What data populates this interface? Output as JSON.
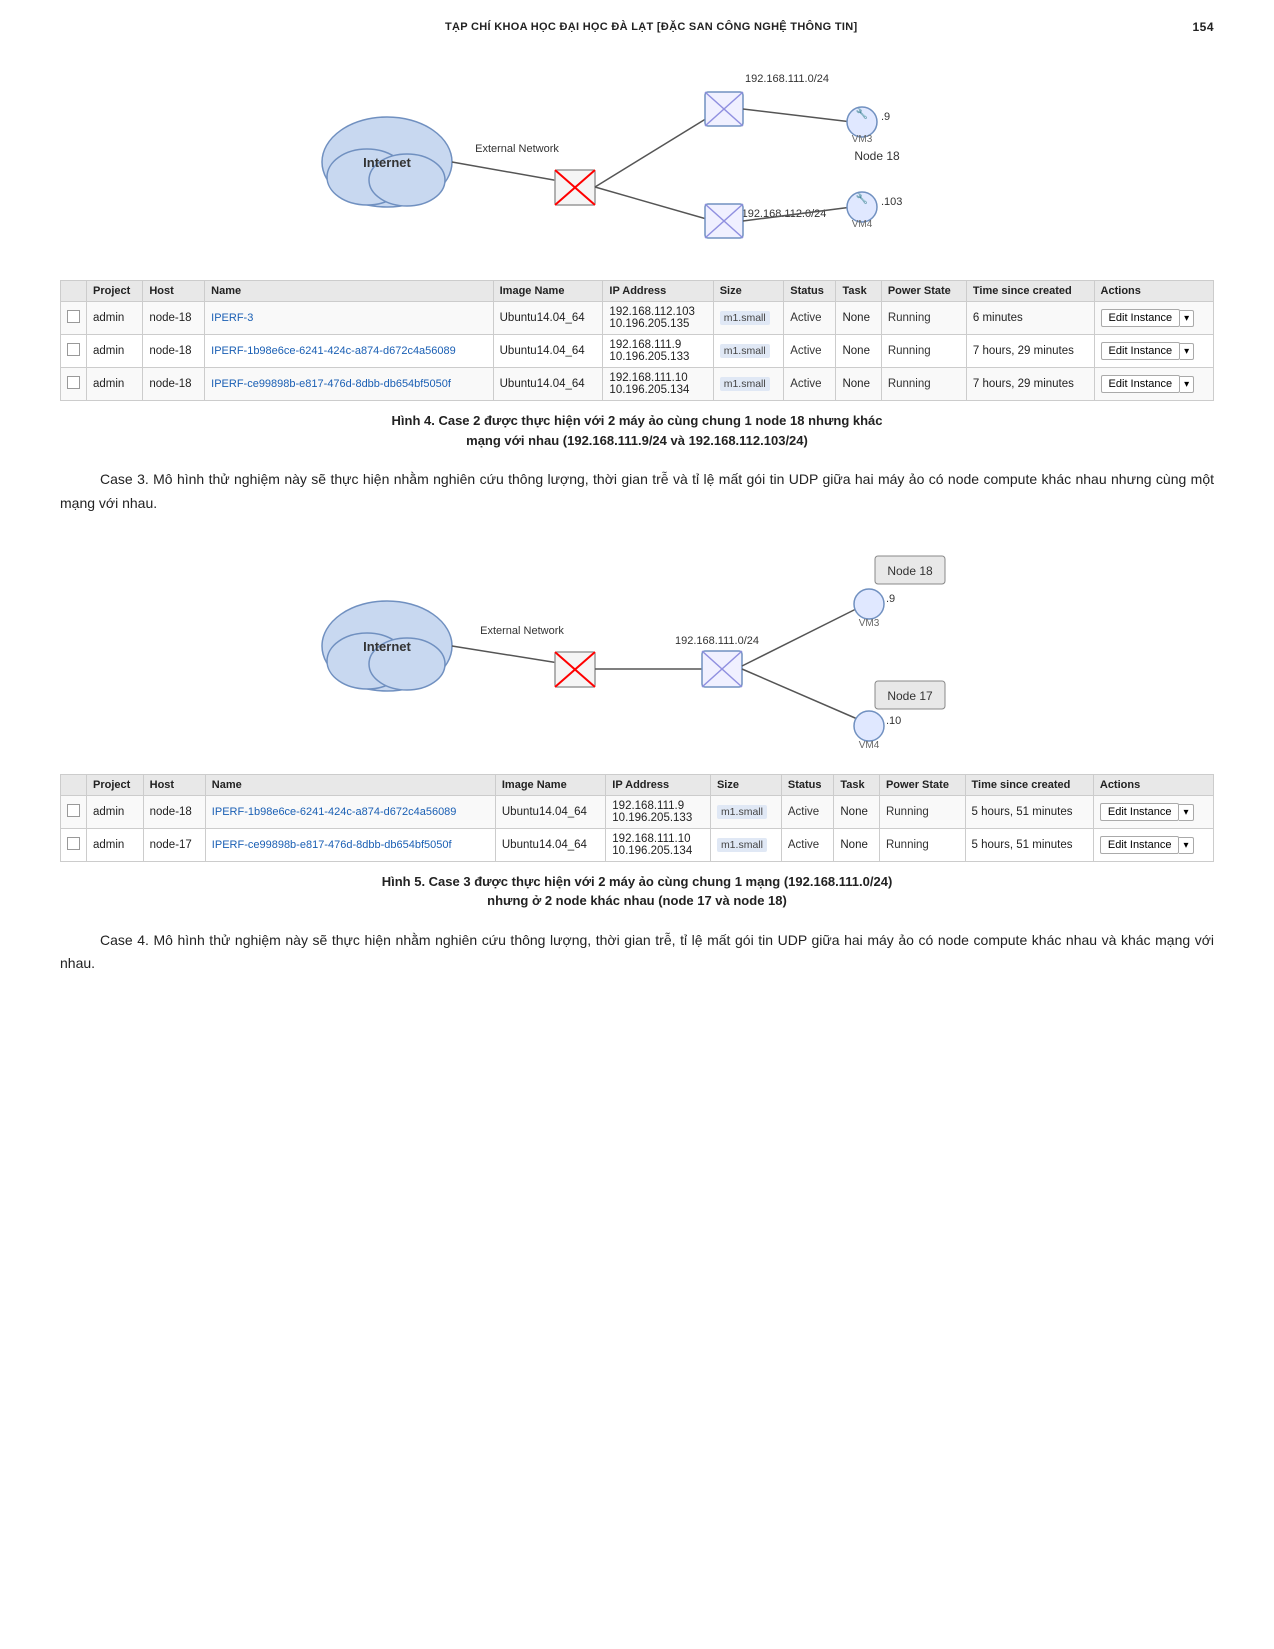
{
  "header": {
    "title": "TẠP CHÍ KHOA HỌC ĐẠI HỌC ĐÀ LẠT [ĐẶC SAN CÔNG NGHỆ THÔNG TIN]",
    "page_number": "154"
  },
  "figure4": {
    "caption_line1": "Hình 4. Case 2 được thực hiện với 2 máy ảo cùng chung 1 node 18 nhưng khác",
    "caption_line2": "mạng với nhau (192.168.111.9/24 và 192.168.112.103/24)"
  },
  "figure5": {
    "caption_line1": "Hình 5. Case 3 được thực hiện với 2 máy ảo cùng chung 1 mạng (192.168.111.0/24)",
    "caption_line2": "nhưng ở 2 node khác nhau (node 17 và node 18)"
  },
  "table4": {
    "rows": [
      {
        "project": "admin",
        "host": "node-18",
        "name": "IPERF-3",
        "image": "Ubuntu14.04_64",
        "ip1": "192.168.112.103",
        "ip2": "10.196.205.135",
        "size": "m1.small",
        "status": "Active",
        "task": "None",
        "power": "Running",
        "time": "6 minutes",
        "action1": "Edit Instance",
        "action2": "▾"
      },
      {
        "project": "admin",
        "host": "node-18",
        "name": "IPERF-1b98e6ce-6241-424c-a874-d672c4a56089",
        "image": "Ubuntu14.04_64",
        "ip1": "192.168.111.9",
        "ip2": "10.196.205.133",
        "size": "m1.small",
        "status": "Active",
        "task": "None",
        "power": "Running",
        "time": "7 hours, 29 minutes",
        "action1": "Edit Instance",
        "action2": "▾"
      },
      {
        "project": "admin",
        "host": "node-18",
        "name": "IPERF-ce99898b-e817-476d-8dbb-db654bf5050f",
        "image": "Ubuntu14.04_64",
        "ip1": "192.168.111.10",
        "ip2": "10.196.205.134",
        "size": "m1.small",
        "status": "Active",
        "task": "None",
        "power": "Running",
        "time": "7 hours, 29 minutes",
        "action1": "Edit Instance",
        "action2": "▾"
      }
    ]
  },
  "table5": {
    "columns": [
      "",
      "Project",
      "Host",
      "Name",
      "Image Name",
      "IP Address",
      "Size",
      "Status",
      "Task",
      "Power State",
      "Time since created",
      "Actions"
    ],
    "rows": [
      {
        "project": "admin",
        "host": "node-18",
        "name": "IPERF-1b98e6ce-6241-424c-a874-d672c4a56089",
        "image": "Ubuntu14.04_64",
        "ip1": "192.168.111.9",
        "ip2": "10.196.205.133",
        "size": "m1.small",
        "status": "Active",
        "task": "None",
        "power": "Running",
        "time": "5 hours, 51 minutes",
        "action1": "Edit Instance",
        "action2": "▾"
      },
      {
        "project": "admin",
        "host": "node-17",
        "name": "IPERF-ce99898b-e817-476d-8dbb-db654bf5050f",
        "image": "Ubuntu14.04_64",
        "ip1": "192.168.111.10",
        "ip2": "10.196.205.134",
        "size": "m1.small",
        "status": "Active",
        "task": "None",
        "power": "Running",
        "time": "5 hours, 51 minutes",
        "action1": "Edit Instance",
        "action2": "▾"
      }
    ]
  },
  "paragraph_case3": "Case 3. Mô hình thử nghiệm này sẽ thực hiện nhằm nghiên cứu thông lượng, thời gian trễ và tỉ lệ mất gói tin UDP giữa hai máy ảo có node compute khác nhau nhưng cùng một mạng với nhau.",
  "paragraph_case4": "Case 4. Mô hình thử nghiệm này sẽ thực hiện nhằm nghiên cứu thông lượng, thời gian trễ, tỉ lệ mất gói tin UDP giữa hai máy ảo có node compute khác nhau và khác mạng với nhau."
}
